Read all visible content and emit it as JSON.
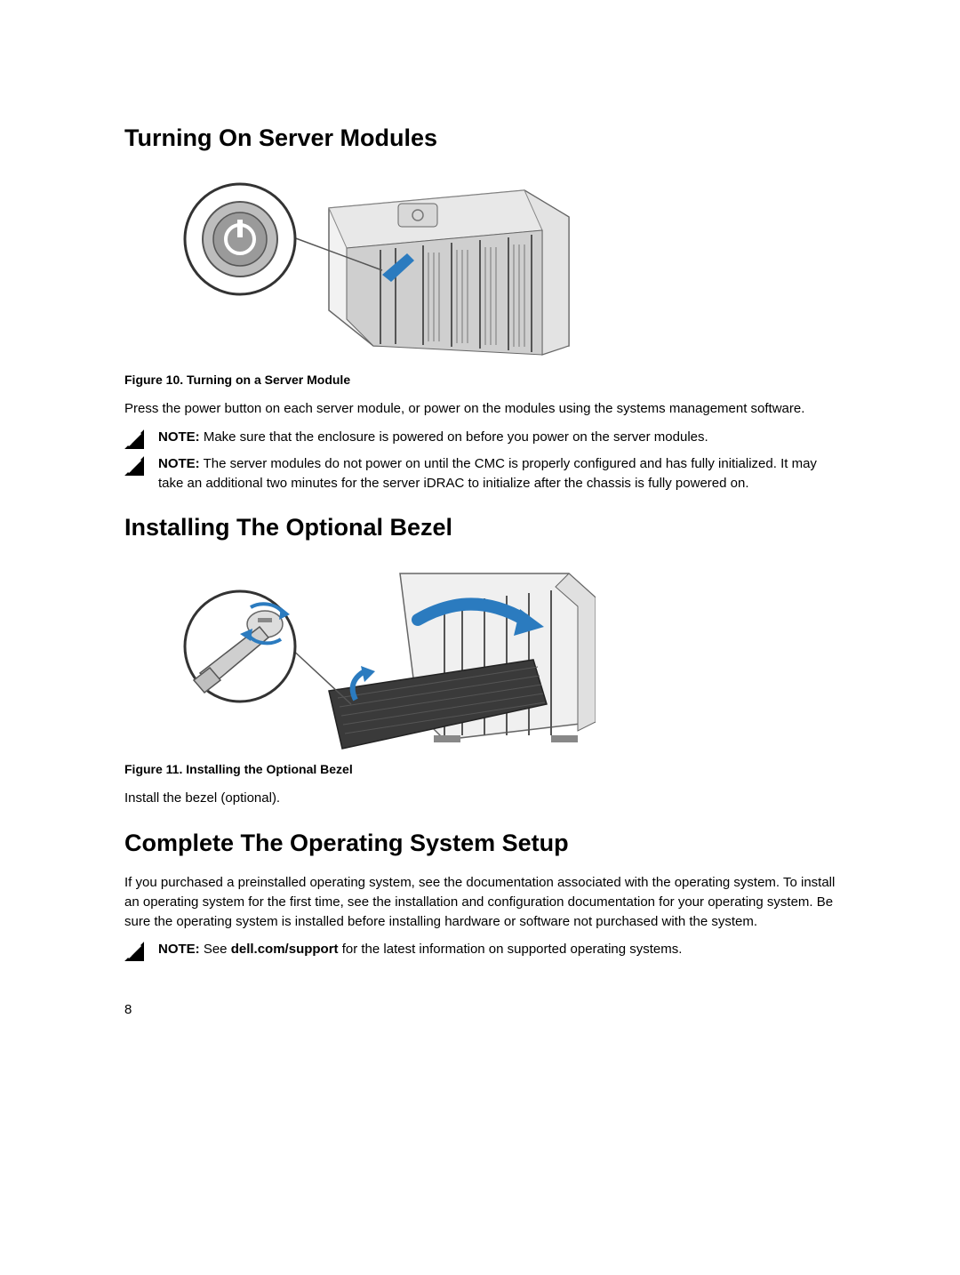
{
  "page_number": "8",
  "sections": {
    "s1": {
      "heading": "Turning On Server Modules",
      "figure_caption": "Figure 10. Turning on a Server Module",
      "body1": "Press the power button on each server module, or power on the modules using the systems management software.",
      "note1_label": "NOTE:",
      "note1_text": " Make sure that the enclosure is powered on before you power on the server modules.",
      "note2_label": "NOTE:",
      "note2_text": " The server modules do not power on until the CMC is properly configured and has fully initialized. It may take an additional two minutes for the server iDRAC to initialize after the chassis is fully powered on."
    },
    "s2": {
      "heading": "Installing The Optional Bezel",
      "figure_caption": "Figure 11. Installing the Optional Bezel",
      "body1": "Install the bezel (optional)."
    },
    "s3": {
      "heading": "Complete The Operating System Setup",
      "body1": "If you purchased a preinstalled operating system, see the documentation associated with the operating system. To install an operating system for the first time, see the installation and configuration documentation for your operating system. Be sure the operating system is installed before installing hardware or software not purchased with the system.",
      "note1_label": "NOTE:",
      "note1_pre": " See ",
      "note1_link": "dell.com/support",
      "note1_post": " for the latest information on supported operating systems."
    }
  }
}
